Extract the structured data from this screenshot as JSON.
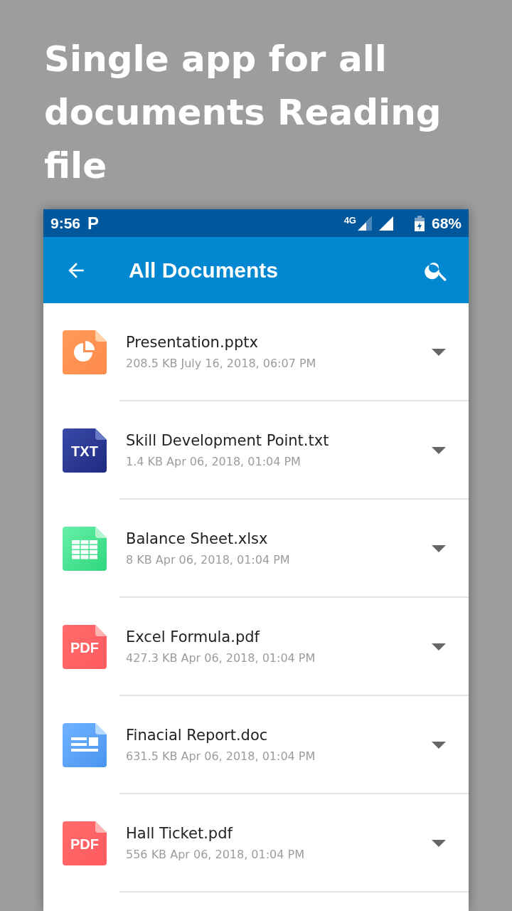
{
  "headline": "Single app for all documents Reading file",
  "status_bar": {
    "time": "9:56",
    "app_letter": "P",
    "network": "4G",
    "battery": "68%"
  },
  "app_bar": {
    "title": "All Documents"
  },
  "files": [
    {
      "kind": "pptx",
      "name": "Presentation.pptx",
      "details": "208.5 KB July 16, 2018, 06:07 PM"
    },
    {
      "kind": "txt",
      "badge": "TXT",
      "name": "Skill Development Point.txt",
      "details": "1.4 KB Apr 06, 2018, 01:04 PM"
    },
    {
      "kind": "xlsx",
      "name": "Balance Sheet.xlsx",
      "details": "8 KB Apr 06, 2018, 01:04 PM"
    },
    {
      "kind": "pdf",
      "badge": "PDF",
      "name": "Excel Formula.pdf",
      "details": "427.3 KB Apr 06, 2018, 01:04 PM"
    },
    {
      "kind": "doc",
      "name": "Finacial Report.doc",
      "details": "631.5 KB Apr 06, 2018, 01:04 PM"
    },
    {
      "kind": "pdf",
      "badge": "PDF",
      "name": "Hall Ticket.pdf",
      "details": "556 KB Apr 06, 2018, 01:04 PM"
    }
  ]
}
